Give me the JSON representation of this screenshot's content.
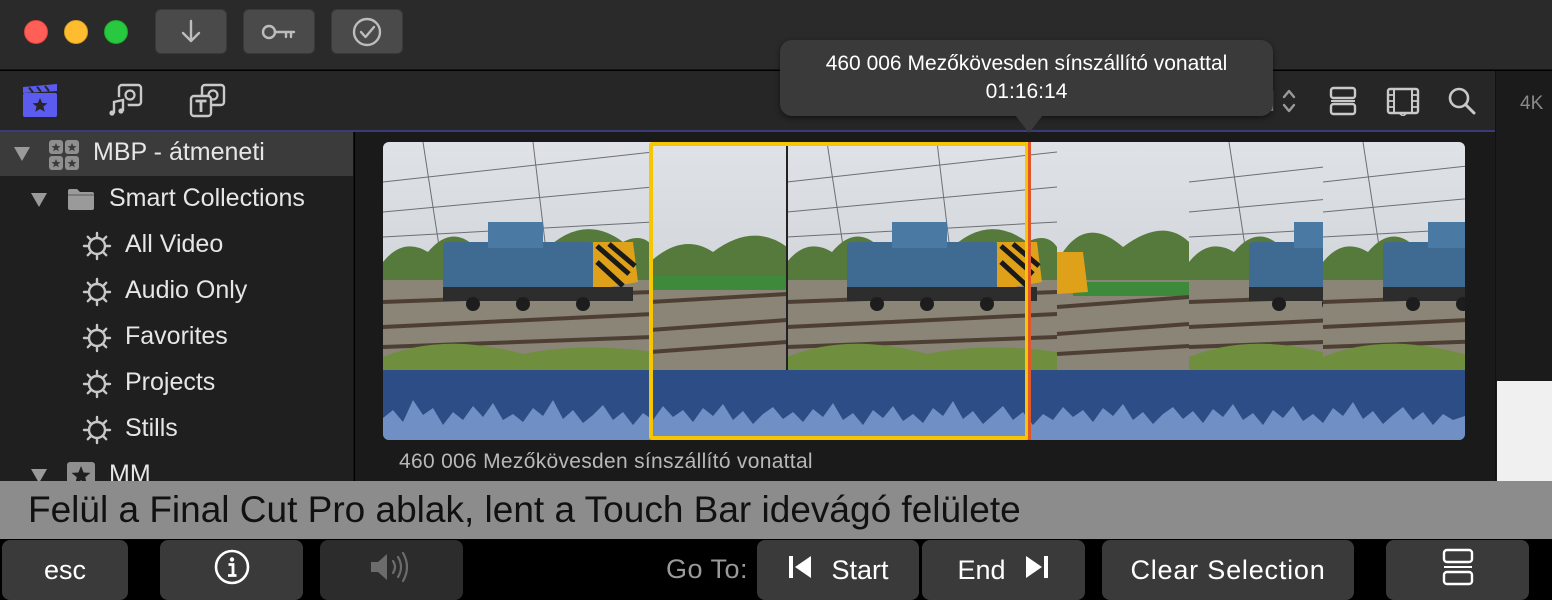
{
  "window": {
    "title_buttons": [
      "download-icon",
      "key-icon",
      "checkmark-circle-icon"
    ]
  },
  "browser_toolbar": {
    "tabs": [
      "libraries-icon",
      "photos-audio-icon",
      "titles-generators-icon"
    ],
    "right_tools": [
      "clip-appearance-icon",
      "filmstrip-icon",
      "search-icon"
    ]
  },
  "inspector": {
    "resolution_badge": "4K"
  },
  "sidebar": {
    "library": {
      "label": "MBP - átmeneti"
    },
    "smart_collections": {
      "label": "Smart Collections"
    },
    "items": [
      {
        "label": "All Video"
      },
      {
        "label": "Audio Only"
      },
      {
        "label": "Favorites"
      },
      {
        "label": "Projects"
      },
      {
        "label": "Stills"
      }
    ],
    "event": {
      "label": "MM"
    }
  },
  "clip": {
    "name": "460 006 Mezőkövesden sínszállító vonattal"
  },
  "tooltip": {
    "title": "460 006 Mezőkövesden sínszállító vonattal",
    "timecode": "01:16:14"
  },
  "caption": "Felül a Final Cut Pro ablak, lent a Touch Bar idevágó felülete",
  "touchbar": {
    "esc": "esc",
    "goto_label": "Go To:",
    "start": "Start",
    "end": "End",
    "clear_selection": "Clear Selection"
  },
  "colors": {
    "selection": "#f7c600",
    "playhead": "#e2562b",
    "audio_waveform": "#2d4d86",
    "accent": "#5b5bf0"
  }
}
